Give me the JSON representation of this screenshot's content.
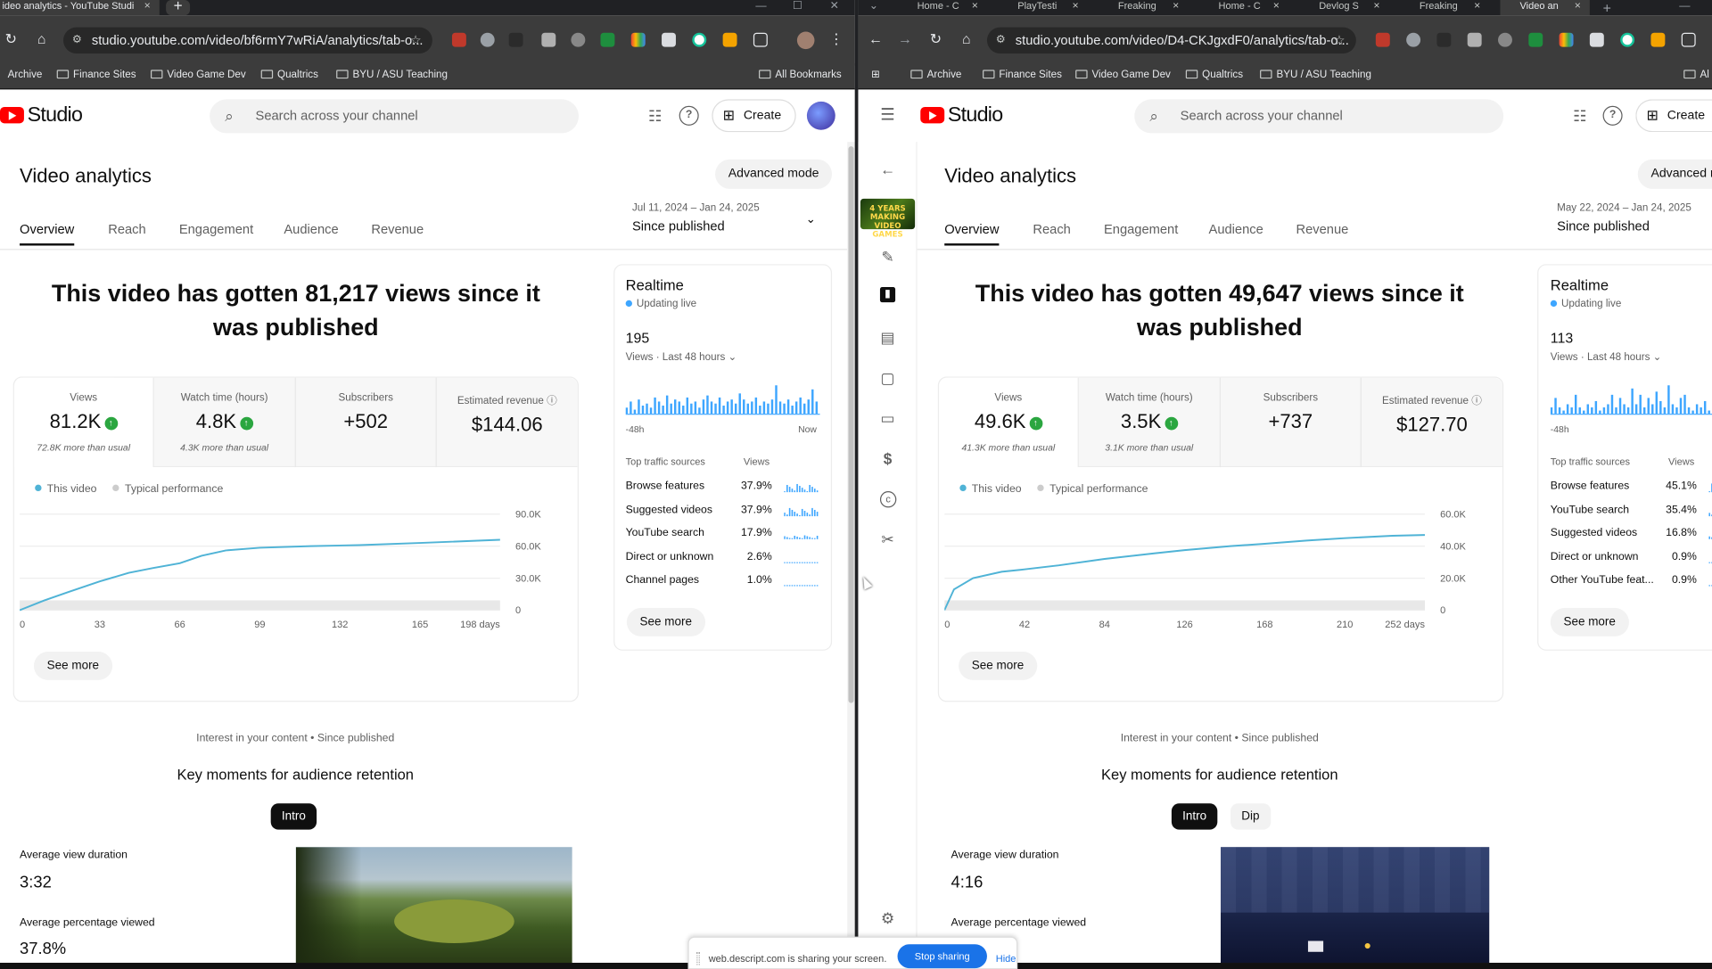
{
  "left": {
    "tabs": [
      {
        "label": "ideo analytics - YouTube Studi"
      }
    ],
    "url": "studio.youtube.com/video/bf6rmY7wRiA/analytics/tab-o...",
    "bookmarks": [
      "Archive",
      "Finance Sites",
      "Video Game Dev",
      "Qualtrics",
      "BYU / ASU Teaching",
      "All Bookmarks"
    ],
    "studio_label": "Studio",
    "search_placeholder": "Search across your channel",
    "create_label": "Create",
    "page_title": "Video analytics",
    "advanced_label": "Advanced mode",
    "nav_tabs": [
      "Overview",
      "Reach",
      "Engagement",
      "Audience",
      "Revenue"
    ],
    "date_range": "Jul 11, 2024 – Jan 24, 2025",
    "date_label": "Since published",
    "headline": "This video has gotten 81,217 views since it was published",
    "kpis": [
      {
        "label": "Views",
        "value": "81.2K",
        "sub": "72.8K more than usual",
        "up": true
      },
      {
        "label": "Watch time (hours)",
        "value": "4.8K",
        "sub": "4.3K more than usual",
        "up": true
      },
      {
        "label": "Subscribers",
        "value": "+502",
        "sub": "",
        "up": false
      },
      {
        "label": "Estimated revenue",
        "value": "$144.06",
        "sub": "",
        "up": false
      }
    ],
    "legend": {
      "this_video": "This video",
      "typical": "Typical performance"
    },
    "see_more": "See more",
    "realtime": {
      "title": "Realtime",
      "live": "Updating live",
      "count": "195",
      "sub": "Views · Last 48 hours",
      "axis_start": "-48h",
      "axis_end": "Now",
      "sources_header": "Top traffic sources",
      "views_header": "Views",
      "sources": [
        {
          "name": "Browse features",
          "pct": "37.9%"
        },
        {
          "name": "Suggested videos",
          "pct": "37.9%"
        },
        {
          "name": "YouTube search",
          "pct": "17.9%"
        },
        {
          "name": "Direct or unknown",
          "pct": "2.6%"
        },
        {
          "name": "Channel pages",
          "pct": "1.0%"
        }
      ],
      "see_more": "See more"
    },
    "interest": "Interest in your content • Since published",
    "key_moments": "Key moments for audience retention",
    "chips": [
      "Intro"
    ],
    "avd_label": "Average view duration",
    "avd_value": "3:32",
    "apv_label": "Average percentage viewed",
    "apv_value": "37.8%"
  },
  "right": {
    "tabs": [
      {
        "label": "Home - C"
      },
      {
        "label": "PlayTesti"
      },
      {
        "label": "Freaking"
      },
      {
        "label": "Home - C"
      },
      {
        "label": "Devlog S"
      },
      {
        "label": "Freaking"
      },
      {
        "label": "Video an"
      }
    ],
    "url": "studio.youtube.com/video/D4-CKJgxdF0/analytics/tab-o...",
    "bookmarks": [
      "Archive",
      "Finance Sites",
      "Video Game Dev",
      "Qualtrics",
      "BYU / ASU Teaching",
      "Al"
    ],
    "studio_label": "Studio",
    "search_placeholder": "Search across your channel",
    "create_label": "Create",
    "page_title": "Video analytics",
    "advanced_label": "Advanced r",
    "nav_tabs": [
      "Overview",
      "Reach",
      "Engagement",
      "Audience",
      "Revenue"
    ],
    "date_range": "May 22, 2024 – Jan 24, 2025",
    "date_label": "Since published",
    "headline": "This video has gotten 49,647 views since it was published",
    "kpis": [
      {
        "label": "Views",
        "value": "49.6K",
        "sub": "41.3K more than usual",
        "up": true
      },
      {
        "label": "Watch time (hours)",
        "value": "3.5K",
        "sub": "3.1K more than usual",
        "up": true
      },
      {
        "label": "Subscribers",
        "value": "+737",
        "sub": "",
        "up": false
      },
      {
        "label": "Estimated revenue",
        "value": "$127.70",
        "sub": "",
        "up": false
      }
    ],
    "legend": {
      "this_video": "This video",
      "typical": "Typical performance"
    },
    "see_more": "See more",
    "realtime": {
      "title": "Realtime",
      "live": "Updating live",
      "count": "113",
      "sub": "Views · Last 48 hours",
      "axis_start": "-48h",
      "axis_end": "",
      "sources_header": "Top traffic sources",
      "views_header": "Views",
      "sources": [
        {
          "name": "Browse features",
          "pct": "45.1%"
        },
        {
          "name": "YouTube search",
          "pct": "35.4%"
        },
        {
          "name": "Suggested videos",
          "pct": "16.8%"
        },
        {
          "name": "Direct or unknown",
          "pct": "0.9%"
        },
        {
          "name": "Other YouTube feat...",
          "pct": "0.9%"
        }
      ],
      "see_more": "See more"
    },
    "interest": "Interest in your content • Since published",
    "key_moments": "Key moments for audience retention",
    "chips": [
      "Intro",
      "Dip"
    ],
    "avd_label": "Average view duration",
    "avd_value": "4:16",
    "apv_label": "Average percentage viewed"
  },
  "share_bar": {
    "text": "web.descript.com is sharing your screen.",
    "stop": "Stop sharing",
    "hide": "Hide"
  },
  "colors": {
    "accent_line": "#4fb3d6",
    "typical_band": "#e8e8e8",
    "up_green": "#2ba640",
    "brand_red": "#ff0000"
  },
  "chart_data": [
    {
      "type": "line",
      "x": [
        0,
        10,
        20,
        33,
        45,
        55,
        66,
        75,
        85,
        99,
        120,
        140,
        165,
        198
      ],
      "series": [
        {
          "values": [
            0,
            9000,
            17000,
            27000,
            35000,
            39500,
            44000,
            51000,
            56000,
            58500,
            60000,
            61000,
            63000,
            66000
          ]
        }
      ],
      "x_ticks": [
        "0",
        "33",
        "66",
        "99",
        "132",
        "165",
        "198 days"
      ],
      "y_ticks": [
        "90.0K",
        "60.0K",
        "30.0K",
        "0"
      ],
      "xlim": [
        0,
        198
      ],
      "ylim": [
        0,
        90000
      ]
    },
    {
      "type": "line",
      "x": [
        0,
        5,
        15,
        30,
        42,
        60,
        84,
        110,
        126,
        150,
        168,
        190,
        210,
        235,
        252
      ],
      "series": [
        {
          "values": [
            0,
            13000,
            20000,
            24000,
            25500,
            28000,
            32000,
            35500,
            37500,
            40000,
            41500,
            43500,
            45000,
            46500,
            47000
          ]
        }
      ],
      "x_ticks": [
        "0",
        "42",
        "84",
        "126",
        "168",
        "210",
        "252 days"
      ],
      "y_ticks": [
        "60.0K",
        "40.0K",
        "20.0K",
        "0"
      ],
      "xlim": [
        0,
        252
      ],
      "ylim": [
        0,
        60000
      ]
    },
    {
      "type": "bar",
      "values": [
        3,
        6,
        2,
        7,
        4,
        5,
        3,
        8,
        6,
        4,
        9,
        5,
        7,
        6,
        4,
        8,
        5,
        6,
        3,
        7,
        9,
        6,
        5,
        8,
        4,
        6,
        7,
        5,
        10,
        7,
        5,
        6,
        8,
        4,
        6,
        5,
        7,
        14,
        6,
        5,
        7,
        4,
        6,
        8,
        5,
        7,
        12,
        6
      ]
    },
    {
      "type": "bar",
      "values": [
        2,
        5,
        2,
        1,
        3,
        2,
        6,
        2,
        1,
        3,
        2,
        4,
        1,
        2,
        3,
        6,
        2,
        5,
        3,
        2,
        8,
        3,
        6,
        2,
        5,
        3,
        7,
        4,
        2,
        9,
        3,
        2,
        5,
        6,
        2,
        1,
        3,
        2,
        4,
        1,
        2,
        2,
        3,
        1,
        2,
        4,
        2,
        3
      ]
    }
  ]
}
